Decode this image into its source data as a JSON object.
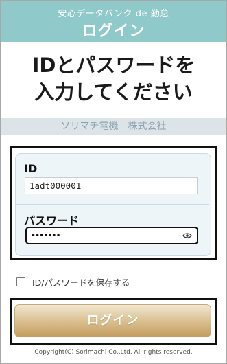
{
  "header": {
    "subtitle": "安心データバンク de 勤怠",
    "title": "ログイン"
  },
  "headline": {
    "line1": "IDとパスワードを",
    "line2": "入力してください"
  },
  "company": "ソリマチ電機　株式会社",
  "form": {
    "id_label": "ID",
    "id_value": "1adt000001",
    "password_label": "パスワード",
    "password_value": "•••••••",
    "show_password_icon": "eye-icon"
  },
  "remember": {
    "label": "ID/パスワードを保存する",
    "checked": false
  },
  "login_button": "ログイン",
  "copyright": "Copyright(C) Sorimachi Co.,Ltd. All rights reserved.",
  "colors": {
    "header_bg": "#8fc9c9",
    "company_bg": "#dde4e7",
    "button_gold": "#c59d5f"
  }
}
